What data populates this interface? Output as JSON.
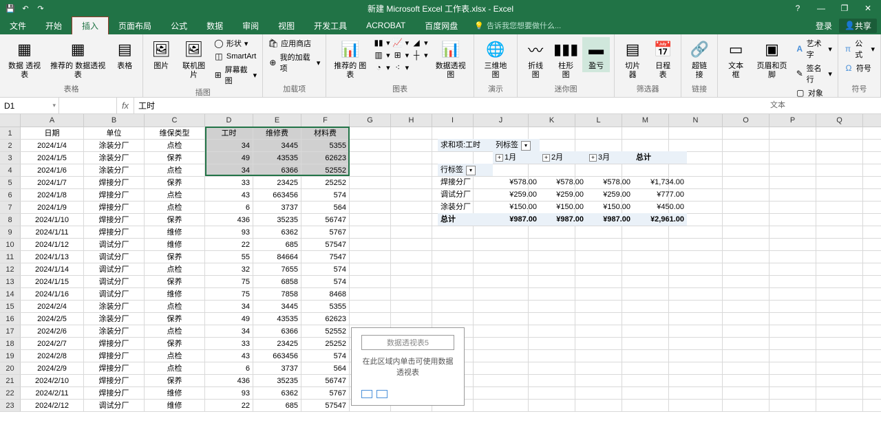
{
  "titlebar": {
    "title": "新建 Microsoft Excel 工作表.xlsx - Excel",
    "qat_save": "💾",
    "qat_undo": "↶",
    "qat_redo": "↷"
  },
  "window": {
    "help": "?",
    "min": "—",
    "max": "❐",
    "close": "✕"
  },
  "tabs": {
    "file": "文件",
    "home": "开始",
    "insert": "插入",
    "layout": "页面布局",
    "formula": "公式",
    "data": "数据",
    "review": "审阅",
    "view": "视图",
    "devtools": "开发工具",
    "acrobat": "ACROBAT",
    "baidu": "百度网盘",
    "tellme": "告诉我您想要做什么...",
    "login": "登录",
    "share": "共享"
  },
  "ribbon": {
    "pivot": "数据\n透视表",
    "rec_pivot": "推荐的\n数据透视表",
    "table": "表格",
    "g_tables": "表格",
    "pic": "图片",
    "online_pic": "联机图片",
    "shapes": "形状",
    "smartart": "SmartArt",
    "screenshot": "屏幕截图",
    "g_illust": "插图",
    "store": "应用商店",
    "addins": "我的加载项",
    "g_addins": "加载项",
    "rec_charts": "推荐的\n图表",
    "pivot_chart": "数据透视图",
    "g_charts": "图表",
    "map3d": "三维地\n图",
    "g_demo": "演示",
    "spark_line": "折线图",
    "spark_col": "柱形图",
    "spark_wl": "盈亏",
    "g_spark": "迷你图",
    "slicer": "切片器",
    "timeline": "日程表",
    "g_filter": "筛选器",
    "hyperlink": "超链接",
    "g_link": "链接",
    "textbox": "文本框",
    "headerfooter": "页眉和页脚",
    "wordart": "艺术字",
    "sigline": "签名行",
    "object": "对象",
    "g_text": "文本",
    "equation": "公式",
    "symbol": "符号",
    "g_symbols": "符号"
  },
  "fbar": {
    "name": "D1",
    "fx": "fx",
    "formula": "工时"
  },
  "cols": [
    "A",
    "B",
    "C",
    "D",
    "E",
    "F",
    "G",
    "H",
    "I",
    "J",
    "K",
    "L",
    "M",
    "N",
    "O",
    "P",
    "Q"
  ],
  "headers": {
    "A": "日期",
    "B": "单位",
    "C": "维保类型",
    "D": "工时",
    "E": "维修费",
    "F": "材料费"
  },
  "rows": [
    [
      "2024/1/4",
      "涂装分厂",
      "点检",
      "34",
      "3445",
      "5355"
    ],
    [
      "2024/1/5",
      "涂装分厂",
      "保养",
      "49",
      "43535",
      "62623"
    ],
    [
      "2024/1/6",
      "涂装分厂",
      "点检",
      "34",
      "6366",
      "52552"
    ],
    [
      "2024/1/7",
      "焊接分厂",
      "保养",
      "33",
      "23425",
      "25252"
    ],
    [
      "2024/1/8",
      "焊接分厂",
      "点检",
      "43",
      "663456",
      "574"
    ],
    [
      "2024/1/9",
      "焊接分厂",
      "点检",
      "6",
      "3737",
      "564"
    ],
    [
      "2024/1/10",
      "焊接分厂",
      "保养",
      "436",
      "35235",
      "56747"
    ],
    [
      "2024/1/11",
      "焊接分厂",
      "维修",
      "93",
      "6362",
      "5767"
    ],
    [
      "2024/1/12",
      "调试分厂",
      "维修",
      "22",
      "685",
      "57547"
    ],
    [
      "2024/1/13",
      "调试分厂",
      "保养",
      "55",
      "84664",
      "7547"
    ],
    [
      "2024/1/14",
      "调试分厂",
      "点检",
      "32",
      "7655",
      "574"
    ],
    [
      "2024/1/15",
      "调试分厂",
      "保养",
      "75",
      "6858",
      "574"
    ],
    [
      "2024/1/16",
      "调试分厂",
      "维修",
      "75",
      "7858",
      "8468"
    ],
    [
      "2024/2/4",
      "涂装分厂",
      "点检",
      "34",
      "3445",
      "5355"
    ],
    [
      "2024/2/5",
      "涂装分厂",
      "保养",
      "49",
      "43535",
      "62623"
    ],
    [
      "2024/2/6",
      "涂装分厂",
      "点检",
      "34",
      "6366",
      "52552"
    ],
    [
      "2024/2/7",
      "焊接分厂",
      "保养",
      "33",
      "23425",
      "25252"
    ],
    [
      "2024/2/8",
      "焊接分厂",
      "点检",
      "43",
      "663456",
      "574"
    ],
    [
      "2024/2/9",
      "焊接分厂",
      "点检",
      "6",
      "3737",
      "564"
    ],
    [
      "2024/2/10",
      "焊接分厂",
      "保养",
      "436",
      "35235",
      "56747"
    ],
    [
      "2024/2/11",
      "焊接分厂",
      "维修",
      "93",
      "6362",
      "5767"
    ],
    [
      "2024/2/12",
      "调试分厂",
      "维修",
      "22",
      "685",
      "57547"
    ]
  ],
  "pivot": {
    "sum_label": "求和项:工时",
    "col_label": "列标签",
    "m1": "1月",
    "m2": "2月",
    "m3": "3月",
    "total_col": "总计",
    "row_label": "行标签",
    "r1": "焊接分厂",
    "r1v": [
      "¥578.00",
      "¥578.00",
      "¥578.00",
      "¥1,734.00"
    ],
    "r2": "调试分厂",
    "r2v": [
      "¥259.00",
      "¥259.00",
      "¥259.00",
      "¥777.00"
    ],
    "r3": "涂装分厂",
    "r3v": [
      "¥150.00",
      "¥150.00",
      "¥150.00",
      "¥450.00"
    ],
    "total_row": "总计",
    "tv": [
      "¥987.00",
      "¥987.00",
      "¥987.00",
      "¥2,961.00"
    ]
  },
  "floating": {
    "title": "数据透视表5",
    "text": "在此区域内单击可使用数据透视表"
  }
}
